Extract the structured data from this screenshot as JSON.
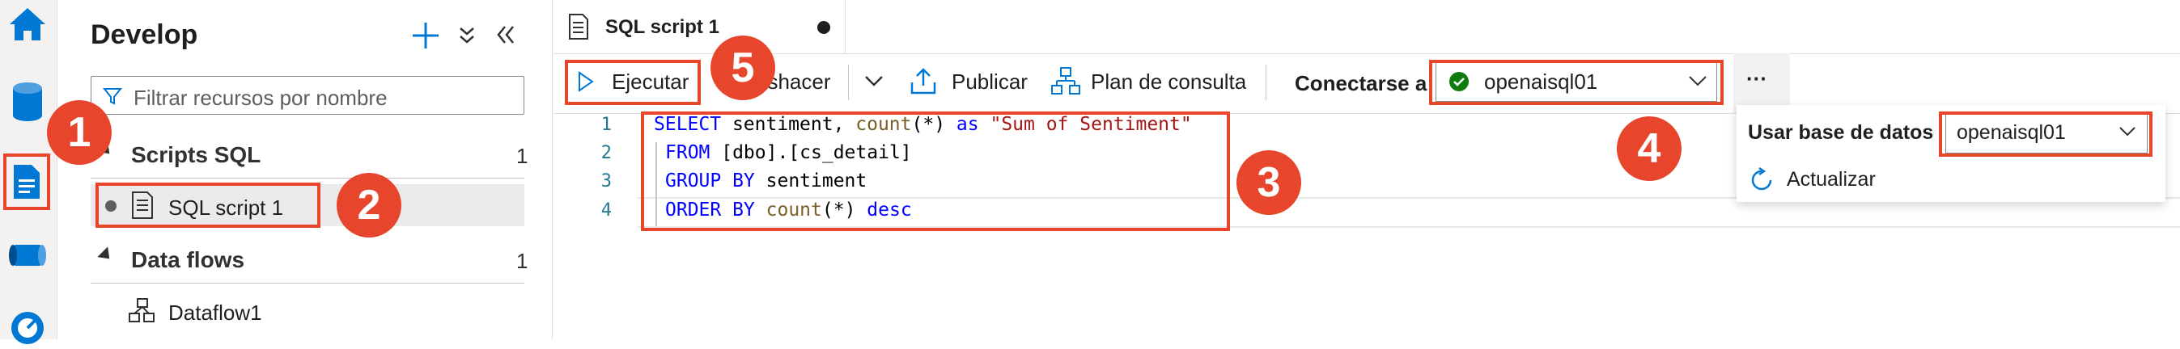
{
  "panel": {
    "title": "Develop",
    "filter_placeholder": "Filtrar recursos por nombre",
    "sections": [
      {
        "label": "Scripts SQL",
        "count": "1",
        "items": [
          {
            "label": "SQL script 1"
          }
        ]
      },
      {
        "label": "Data flows",
        "count": "1",
        "items": [
          {
            "label": "Dataflow1"
          }
        ]
      }
    ]
  },
  "tab": {
    "label": "SQL script 1"
  },
  "toolbar": {
    "run_label": "Ejecutar",
    "undo_label": "eshacer",
    "publish_label": "Publicar",
    "plan_label": "Plan de consulta",
    "connect_label": "Conectarse a",
    "connect_value": "openaisql01",
    "more_label": "···"
  },
  "flyout": {
    "db_label": "Usar base de datos",
    "db_value": "openaisql01",
    "refresh_label": "Actualizar"
  },
  "editor": {
    "line_numbers": [
      "1",
      "2",
      "3",
      "4"
    ]
  },
  "callouts": [
    "1",
    "2",
    "3",
    "4",
    "5"
  ],
  "colors": {
    "accent": "#0078d4",
    "callout": "#e8462c",
    "status_ok": "#107c10"
  }
}
